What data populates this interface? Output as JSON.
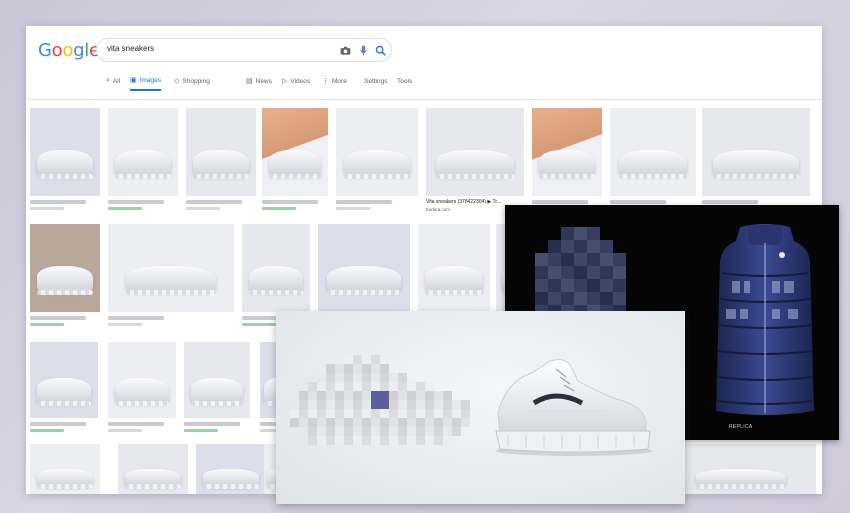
{
  "search": {
    "logo": [
      "G",
      "o",
      "o",
      "g",
      "l",
      "e"
    ],
    "logo_colors": [
      "#4285f4",
      "#ea4335",
      "#fbbc05",
      "#4285f4",
      "#34a853",
      "#ea4335"
    ],
    "query": "vita sneakers",
    "tabs": [
      {
        "label": "All",
        "icon": "search-icon"
      },
      {
        "label": "Images",
        "icon": "image-icon",
        "active": true
      },
      {
        "label": "Shopping",
        "icon": "tag-icon"
      },
      {
        "label": "News",
        "icon": "news-icon"
      },
      {
        "label": "Videos",
        "icon": "play-icon"
      },
      {
        "label": "More",
        "icon": "more-dots-icon"
      }
    ],
    "settings_label": "Settings",
    "tools_label": "Tools"
  },
  "results": {
    "highlighted_caption": "Vita sneakers (378422304) ▶ Tr...",
    "highlighted_source": "tradera.com"
  },
  "overlay_vest": {
    "label": "REPLICA"
  },
  "colors": {
    "accent": "#1a73e8",
    "vest_blue": "#2e3a78"
  }
}
